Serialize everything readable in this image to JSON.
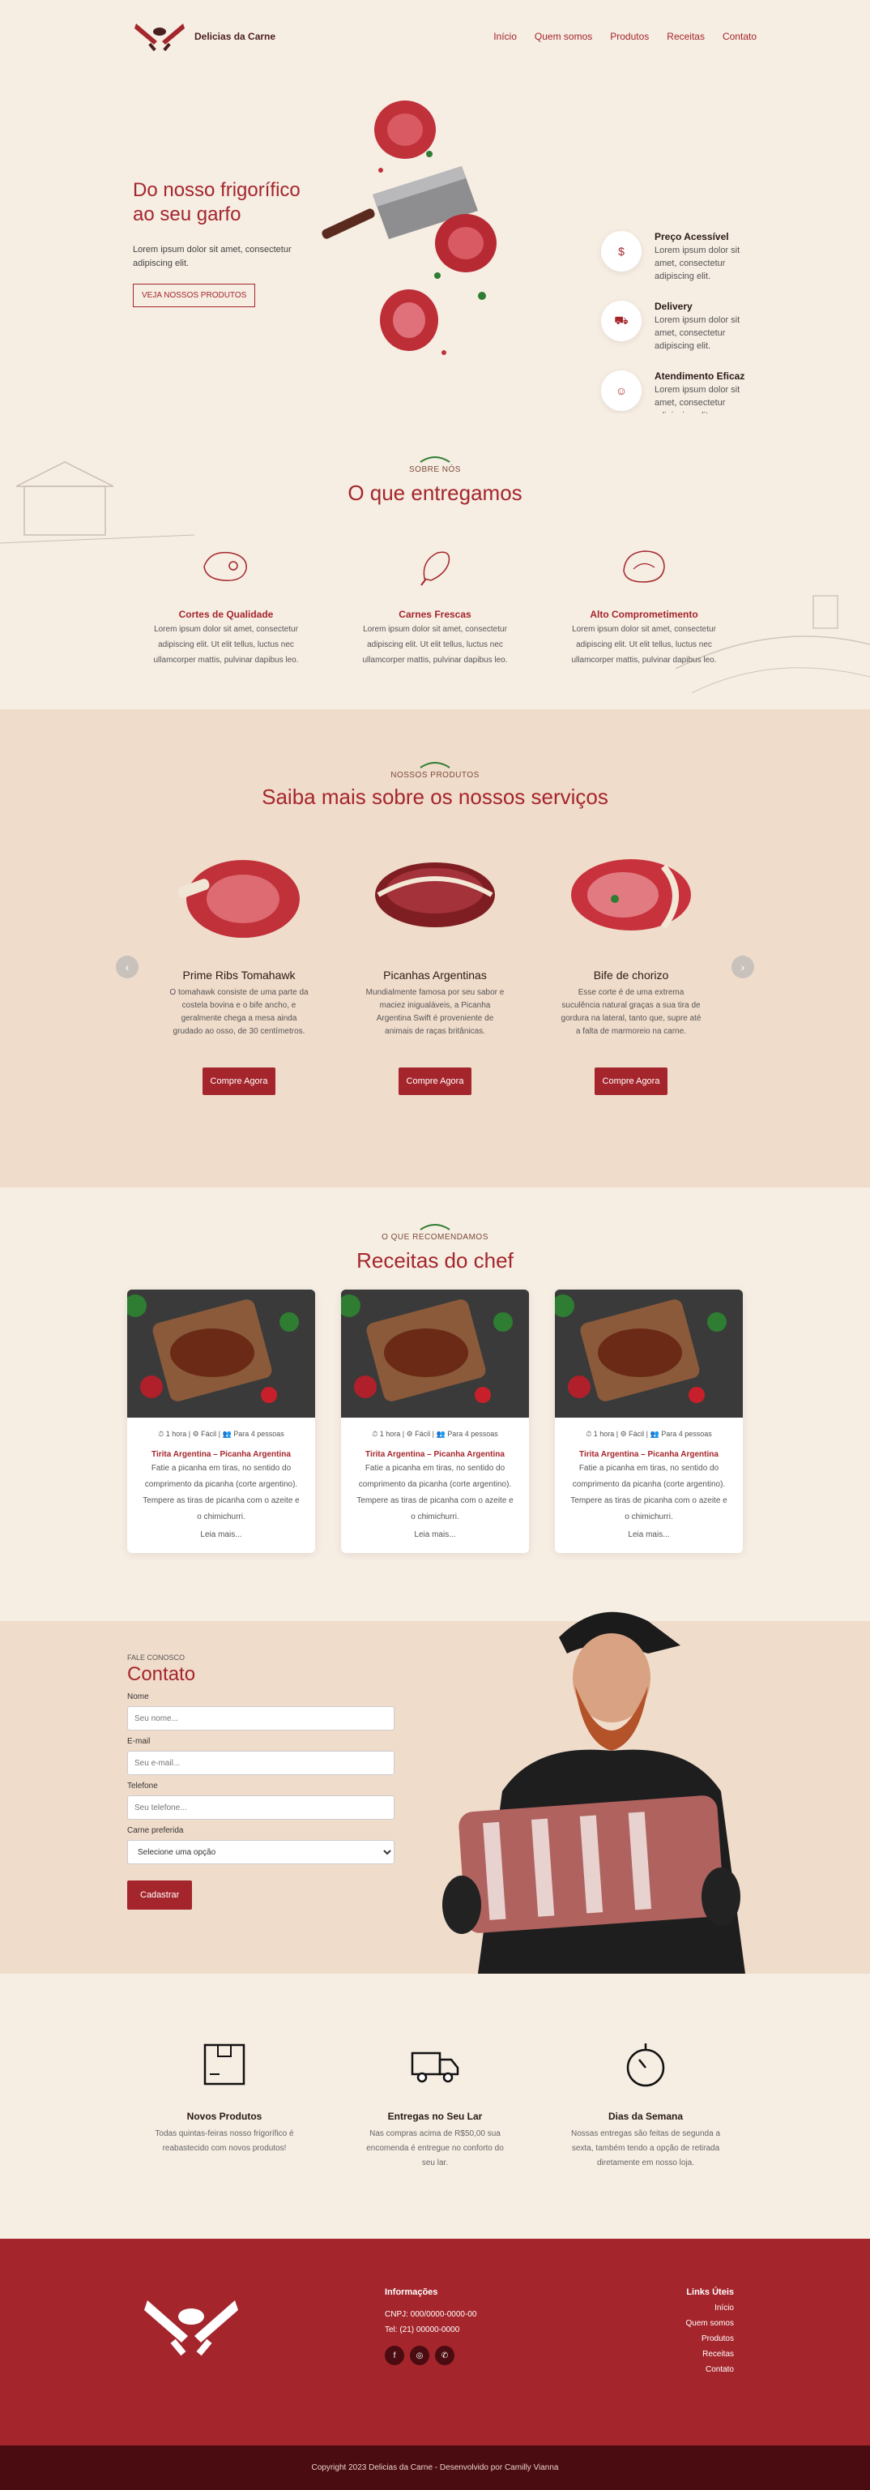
{
  "header": {
    "brand": "Delicias da Carne",
    "nav": [
      "Início",
      "Quem somos",
      "Produtos",
      "Receitas",
      "Contato"
    ]
  },
  "hero": {
    "title": "Do nosso frigorífico ao seu garfo",
    "text": "Lorem ipsum dolor sit amet, consectetur adipiscing elit.",
    "cta": "VEJA NOSSOS PRODUTOS",
    "features": [
      {
        "title": "Preço Acessível",
        "text": "Lorem ipsum dolor sit amet, consectetur adipiscing elit.",
        "icon": "price-tag-icon"
      },
      {
        "title": "Delivery",
        "text": "Lorem ipsum dolor sit amet, consectetur adipiscing elit.",
        "icon": "delivery-truck-icon"
      },
      {
        "title": "Atendimento Eficaz",
        "text": "Lorem ipsum dolor sit amet, consectetur adipiscing elit.",
        "icon": "people-icon"
      }
    ]
  },
  "about": {
    "eyebrow": "SOBRE NÓS",
    "title": "O que entregamos",
    "items": [
      {
        "title": "Cortes de Qualidade",
        "text": "Lorem ipsum dolor sit amet, consectetur adipiscing elit. Ut elit tellus, luctus nec ullamcorper mattis, pulvinar dapibus leo."
      },
      {
        "title": "Carnes Frescas",
        "text": "Lorem ipsum dolor sit amet, consectetur adipiscing elit. Ut elit tellus, luctus nec ullamcorper mattis, pulvinar dapibus leo."
      },
      {
        "title": "Alto Comprometimento",
        "text": "Lorem ipsum dolor sit amet, consectetur adipiscing elit. Ut elit tellus, luctus nec ullamcorper mattis, pulvinar dapibus leo."
      }
    ]
  },
  "products": {
    "eyebrow": "NOSSOS PRODUTOS",
    "title": "Saiba mais sobre os nossos serviços",
    "items": [
      {
        "name": "Prime Ribs Tomahawk",
        "text": "O tomahawk consiste de uma parte da costela bovina e o bife ancho, e geralmente chega a mesa ainda grudado ao osso, de 30 centímetros.",
        "cta": "Compre Agora"
      },
      {
        "name": "Picanhas Argentinas",
        "text": "Mundialmente famosa por seu sabor e maciez inigualáveis, a Picanha Argentina Swift é proveniente de animais de raças britânicas.",
        "cta": "Compre Agora"
      },
      {
        "name": "Bife de chorizo",
        "text": "Esse corte é de uma extrema suculência natural graças a sua tira de gordura na lateral, tanto que, supre até a falta de marmoreio na carne.",
        "cta": "Compre Agora"
      }
    ]
  },
  "recipes": {
    "eyebrow": "O QUE RECOMENDAMOS",
    "title": "Receitas do chef",
    "items": [
      {
        "meta": "⏱ 1 hora  |  ⚙ Fácil  |  👥 Para 4 pessoas",
        "title": "Tirita Argentina – Picanha Argentina",
        "text": "Fatie a picanha em tiras, no sentido do comprimento da picanha (corte argentino). Tempere as tiras de picanha com o azeite e o chimichurri.",
        "more": "Leia mais..."
      },
      {
        "meta": "⏱ 1 hora  |  ⚙ Fácil  |  👥 Para 4 pessoas",
        "title": "Tirita Argentina – Picanha Argentina",
        "text": "Fatie a picanha em tiras, no sentido do comprimento da picanha (corte argentino). Tempere as tiras de picanha com o azeite e o chimichurri.",
        "more": "Leia mais..."
      },
      {
        "meta": "⏱ 1 hora  |  ⚙ Fácil  |  👥 Para 4 pessoas",
        "title": "Tirita Argentina – Picanha Argentina",
        "text": "Fatie a picanha em tiras, no sentido do comprimento da picanha (corte argentino). Tempere as tiras de picanha com o azeite e o chimichurri.",
        "more": "Leia mais..."
      }
    ]
  },
  "contact": {
    "eyebrow": "FALE CONOSCO",
    "title": "Contato",
    "fields": [
      {
        "label": "Nome",
        "placeholder": "Seu nome..."
      },
      {
        "label": "E-mail",
        "placeholder": "Seu e-mail..."
      },
      {
        "label": "Telefone",
        "placeholder": "Seu telefone..."
      }
    ],
    "select_label": "Carne preferida",
    "select_value": "Selecione uma opção",
    "submit": "Cadastrar"
  },
  "benefits": [
    {
      "title": "Novos Produtos",
      "text": "Todas quintas-feiras nosso frigorífico é reabastecido com novos produtos!"
    },
    {
      "title": "Entregas no Seu Lar",
      "text": "Nas compras acima de R$50,00 sua encomenda é entregue no conforto do seu lar."
    },
    {
      "title": "Dias da Semana",
      "text": "Nossas entregas são feitas de segunda a sexta, também tendo a opção de retirada diretamente em nosso loja."
    }
  ],
  "footer": {
    "info_title": "Informações",
    "cnpj": "CNPJ: 000/0000-0000-00",
    "phone": "Tel: (21) 00000-0000",
    "links_title": "Links Úteis",
    "links": [
      "Início",
      "Quem somos",
      "Produtos",
      "Receitas",
      "Contato"
    ],
    "copyright": "Copyright 2023 Delicias da Carne - Desenvolvido por Camilly Vianna"
  },
  "colors": {
    "brand": "#a4262c",
    "cream": "#f6ede3",
    "peach": "#f0dccb",
    "dark": "#4a0c10"
  }
}
